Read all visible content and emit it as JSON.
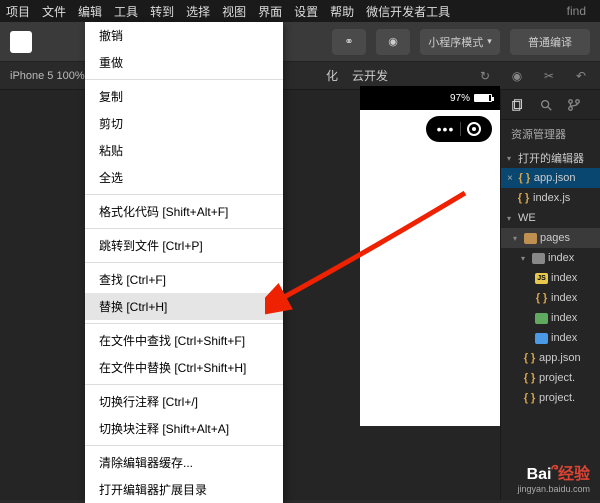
{
  "menubar": [
    "项目",
    "文件",
    "编辑",
    "工具",
    "转到",
    "选择",
    "视图",
    "界面",
    "设置",
    "帮助",
    "微信开发者工具"
  ],
  "find": "find",
  "toolbar": {
    "mode_label": "小程序模式",
    "normal_label": "普通编译",
    "cloud_label": "云开发",
    "compile_label": "化"
  },
  "subbar": {
    "device": "iPhone 5 100%"
  },
  "phone": {
    "battery_pct": "97%"
  },
  "explorer": {
    "title": "资源管理器",
    "open_editors": "打开的编辑器",
    "files": {
      "app_json": "app.json",
      "index_js": "index.js",
      "we": "WE",
      "pages": "pages",
      "index_folder": "index",
      "index1": "index",
      "index2": "index",
      "index3": "index",
      "index4": "index",
      "app_json2": "app.json",
      "project1": "project.",
      "project2": "project."
    }
  },
  "menu": {
    "items": [
      "撤销",
      "重做",
      "",
      "复制",
      "剪切",
      "粘贴",
      "全选",
      "",
      "格式化代码  [Shift+Alt+F]",
      "",
      "跳转到文件  [Ctrl+P]",
      "",
      "查找  [Ctrl+F]",
      "替换  [Ctrl+H]",
      "",
      "在文件中查找  [Ctrl+Shift+F]",
      "在文件中替换  [Ctrl+Shift+H]",
      "",
      "切换行注释  [Ctrl+/]",
      "切换块注释  [Shift+Alt+A]",
      "",
      "清除编辑器缓存...",
      "打开编辑器扩展目录"
    ],
    "hovered_index": 13
  },
  "watermark": {
    "brand_a": "Bai",
    "brand_b": "经验",
    "url": "jingyan.baidu.com"
  }
}
